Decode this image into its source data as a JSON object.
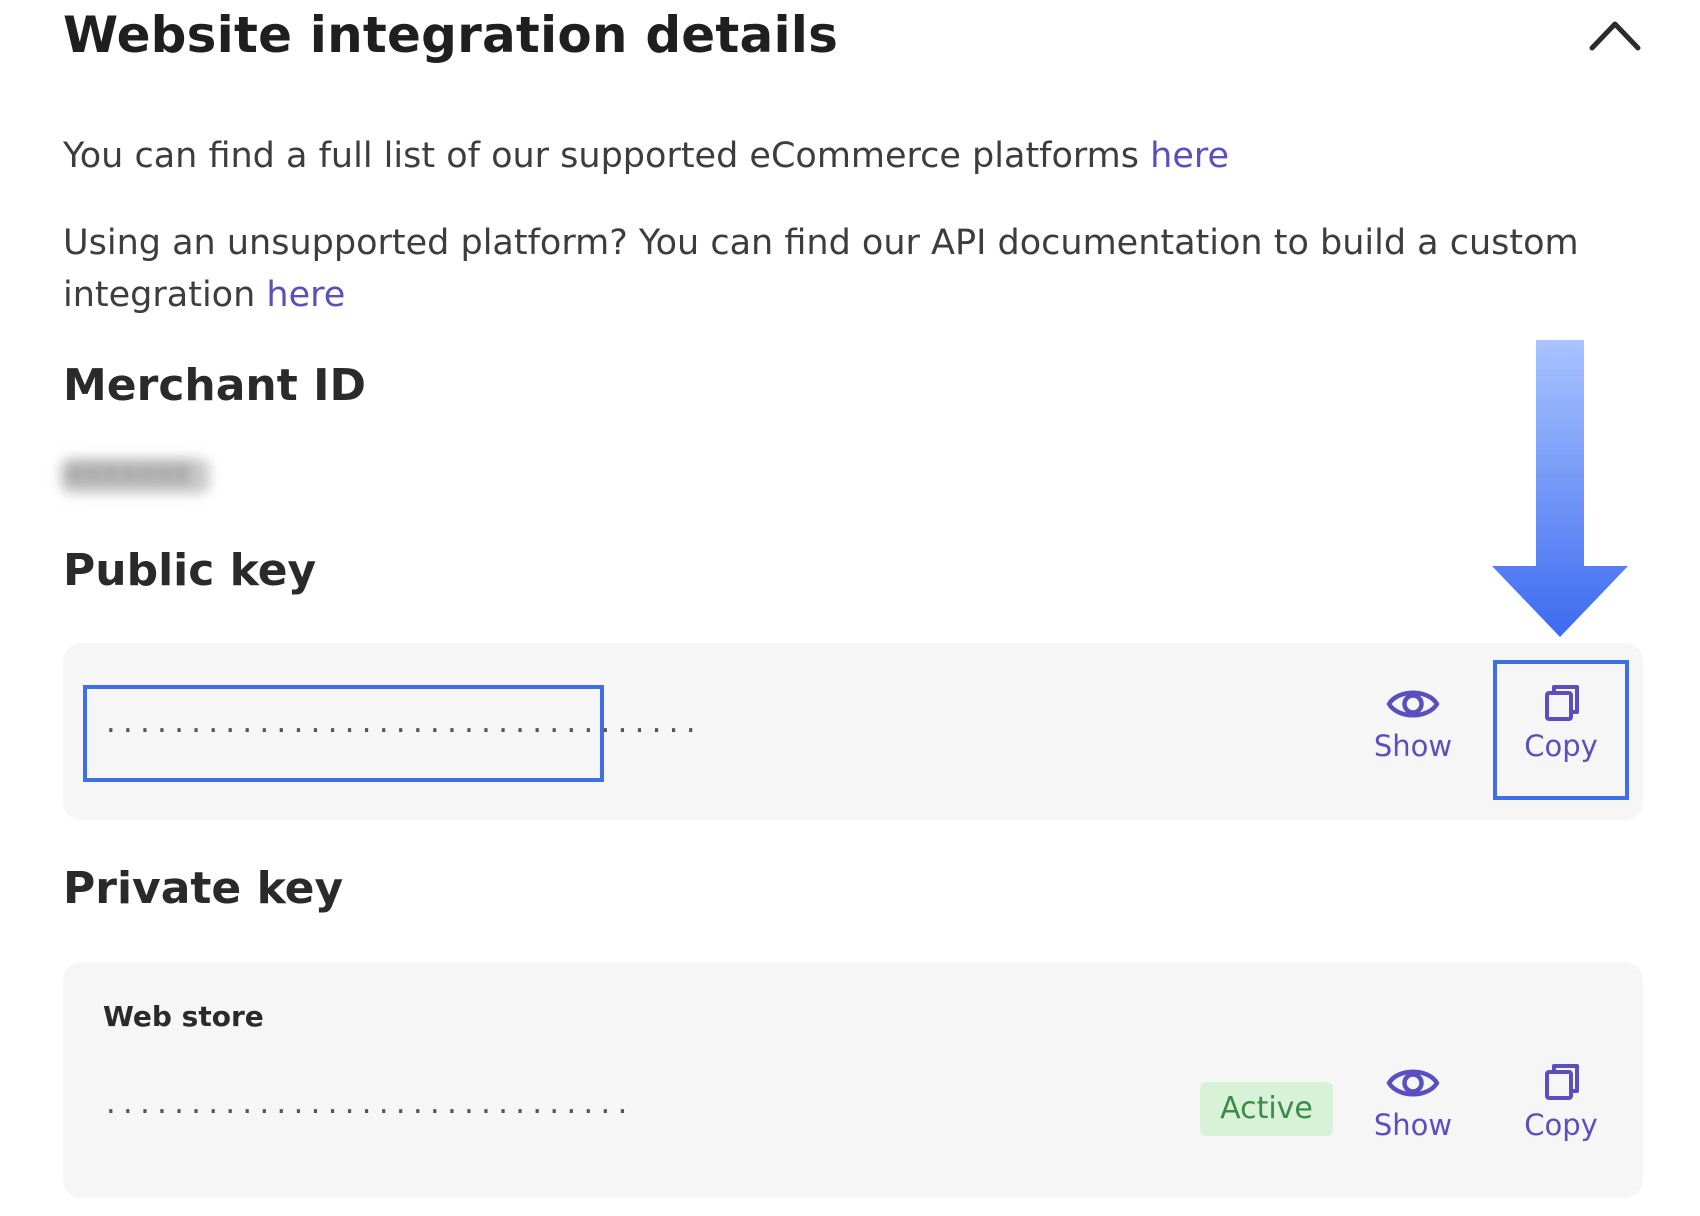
{
  "header": {
    "title": "Website integration details",
    "collapse_icon": "chevron-up-icon"
  },
  "intro": {
    "line1_text": "You can find a full list of our supported eCommerce platforms ",
    "line1_link": "here",
    "line2_text": "Using an unsupported platform? You can find our API documentation to build a custom integration ",
    "line2_link": "here"
  },
  "merchant": {
    "heading": "Merchant ID",
    "value_redacted": "XXXXXXX"
  },
  "public_key": {
    "heading": "Public key",
    "masked_value": "...................................",
    "show_label": "Show",
    "copy_label": "Copy",
    "show_icon": "eye-icon",
    "copy_icon": "copy-icon"
  },
  "private_key": {
    "heading": "Private key",
    "store_label": "Web store",
    "masked_value": "...............................",
    "status": "Active",
    "show_label": "Show",
    "copy_label": "Copy",
    "show_icon": "eye-icon",
    "copy_icon": "copy-icon"
  },
  "colors": {
    "link": "#5a4fbf",
    "highlight": "#3f6fe6",
    "arrow_top": "#a9c4ff",
    "arrow_bottom": "#3d6af0",
    "card_bg": "#f6f6f6",
    "badge_bg": "#d8f2d8",
    "badge_text": "#3c8a48"
  }
}
